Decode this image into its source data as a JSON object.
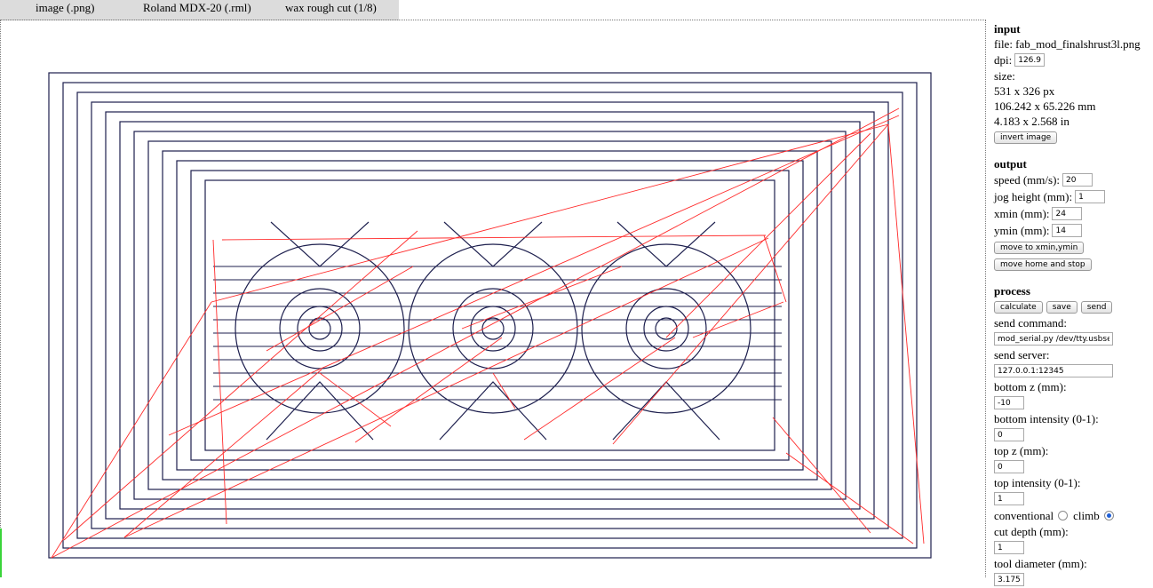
{
  "menu": {
    "format_in": "image (.png)",
    "machine": "Roland MDX-20 (.rml)",
    "process": "wax rough cut (1/8)"
  },
  "input": {
    "title": "input",
    "file": "file: fab_mod_finalshrust3l.png",
    "dpi_label": "dpi:",
    "dpi_value": "126.94",
    "size_label": "size:",
    "size_px": "531 x 326 px",
    "size_mm": "106.242 x 65.226 mm",
    "size_in": "4.183 x 2.568 in",
    "invert_button": "invert image"
  },
  "output": {
    "title": "output",
    "speed_label": "speed (mm/s):",
    "speed_value": "20",
    "jog_label": "jog height (mm):",
    "jog_value": "1",
    "xmin_label": "xmin (mm):",
    "xmin_value": "24",
    "ymin_label": "ymin (mm):",
    "ymin_value": "14",
    "move_xy_button": "move to xmin,ymin",
    "move_home_button": "move home and stop"
  },
  "process": {
    "title": "process",
    "calculate_button": "calculate",
    "save_button": "save",
    "send_button": "send",
    "send_command_label": "send command:",
    "send_command_value": "mod_serial.py /dev/tty.usbserial",
    "send_server_label": "send server:",
    "send_server_value": "127.0.0.1:12345",
    "bottom_z_label": "bottom z (mm):",
    "bottom_z_value": "-10",
    "bottom_intensity_label": "bottom intensity (0-1):",
    "bottom_intensity_value": "0",
    "top_z_label": "top z (mm):",
    "top_z_value": "0",
    "top_intensity_label": "top intensity (0-1):",
    "top_intensity_value": "1",
    "conventional_label": "conventional",
    "climb_label": "climb",
    "direction_selected": "climb",
    "cut_depth_label": "cut depth (mm):",
    "cut_depth_value": "1",
    "tool_diameter_label": "tool diameter (mm):",
    "tool_diameter_value": "3.175"
  },
  "colors": {
    "toolpath": "#1d1f4e",
    "jog_moves": "#ff2a2a"
  }
}
